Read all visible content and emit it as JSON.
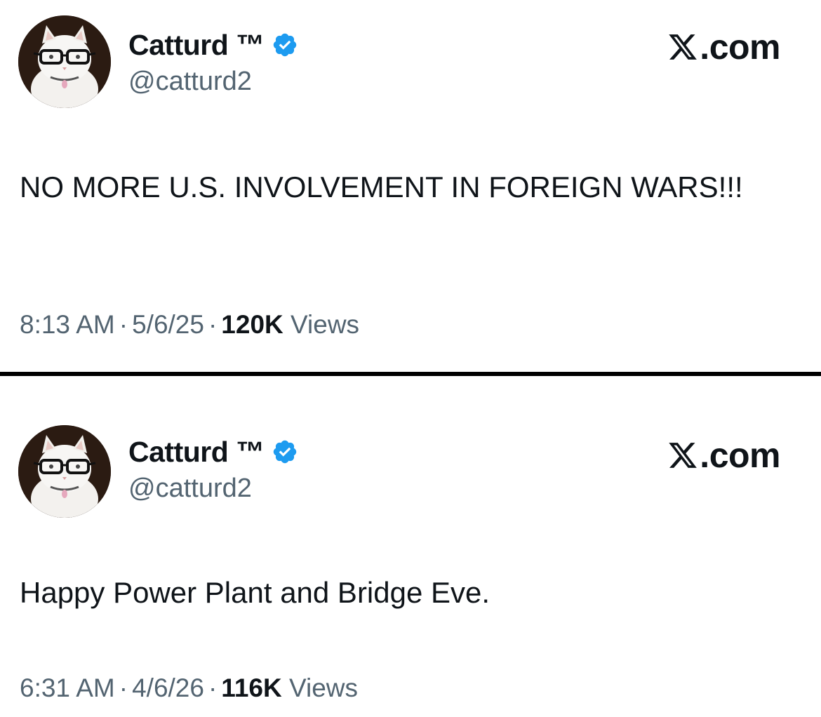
{
  "colors": {
    "text_primary": "#0f1419",
    "text_secondary": "#536471",
    "verified_blue": "#1d9bf0",
    "divider": "#000000"
  },
  "tweets": [
    {
      "display_name": "Catturd ™",
      "handle": "@catturd2",
      "site_label": ".com",
      "site_icon": "x-logo-icon",
      "verified_icon": "verified-badge-icon",
      "avatar_icon": "cat-with-glasses-avatar",
      "text": "NO MORE U.S. INVOLVEMENT IN FOREIGN WARS!!!",
      "time": "8:13 AM",
      "date": "5/6/25",
      "views_count": "120K",
      "views_label": "Views"
    },
    {
      "display_name": "Catturd ™",
      "handle": "@catturd2",
      "site_label": ".com",
      "site_icon": "x-logo-icon",
      "verified_icon": "verified-badge-icon",
      "avatar_icon": "cat-with-glasses-avatar",
      "text": "Happy Power Plant and Bridge Eve.",
      "time": "6:31 AM",
      "date": "4/6/26",
      "views_count": "116K",
      "views_label": "Views"
    }
  ]
}
